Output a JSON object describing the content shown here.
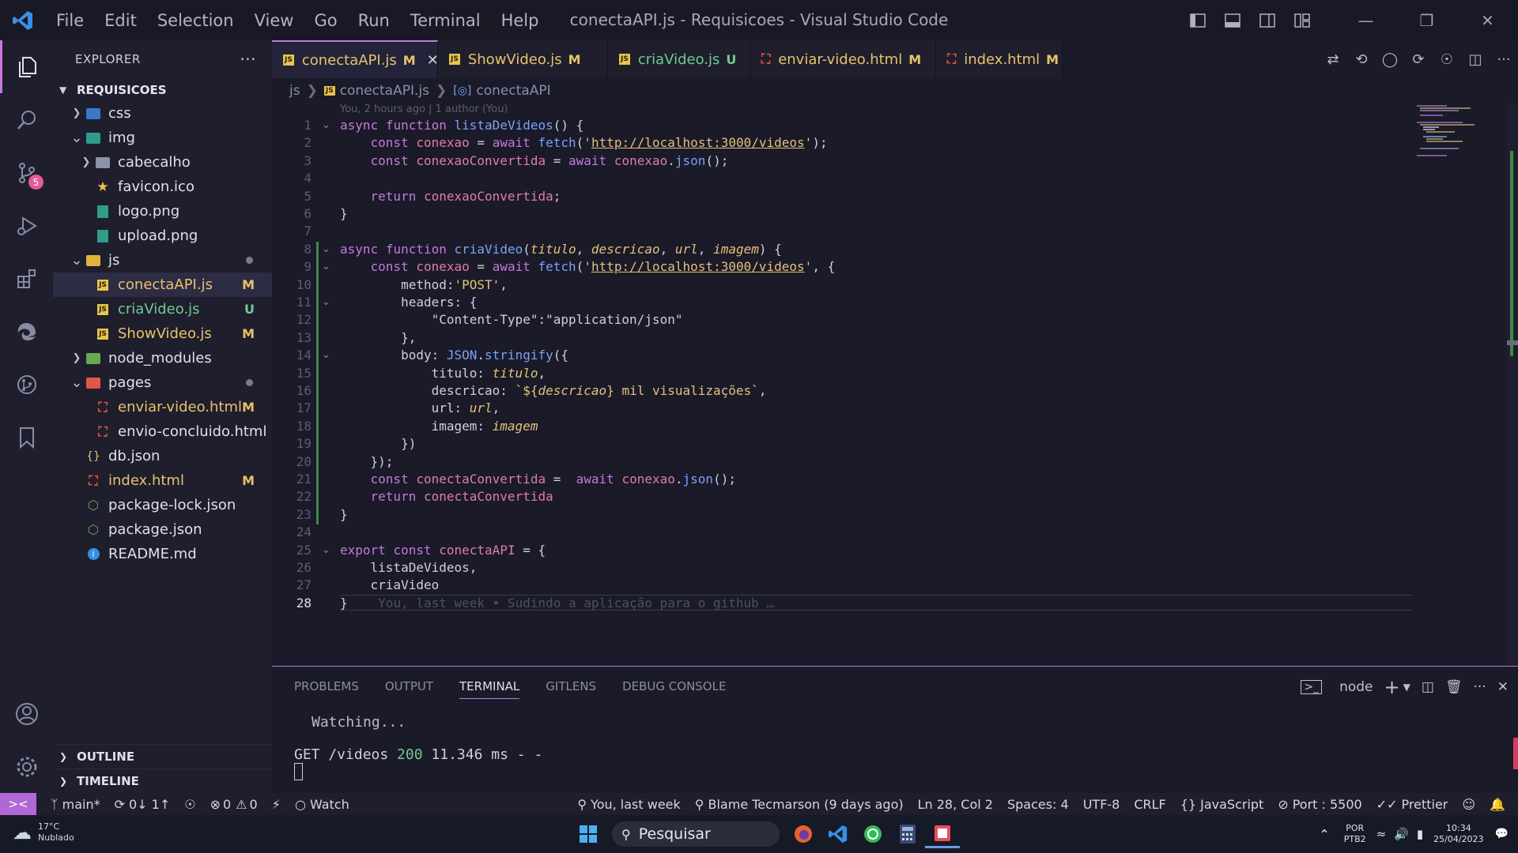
{
  "window": {
    "title": "conectaAPI.js - Requisicoes - Visual Studio Code",
    "menu": [
      "File",
      "Edit",
      "Selection",
      "View",
      "Go",
      "Run",
      "Terminal",
      "Help"
    ]
  },
  "activity_bar": {
    "scm_badge": "5"
  },
  "explorer": {
    "header": "EXPLORER",
    "root": "REQUISICOES",
    "items": [
      {
        "label": "css",
        "depth": 1,
        "kind": "folder-css",
        "expanded": false,
        "status": "",
        "color": ""
      },
      {
        "label": "img",
        "depth": 1,
        "kind": "folder-img",
        "expanded": true,
        "status": "",
        "color": ""
      },
      {
        "label": "cabecalho",
        "depth": 2,
        "kind": "folder",
        "expanded": false,
        "status": "",
        "color": ""
      },
      {
        "label": "favicon.ico",
        "depth": 2,
        "kind": "star",
        "status": "",
        "color": ""
      },
      {
        "label": "logo.png",
        "depth": 2,
        "kind": "image",
        "status": "",
        "color": ""
      },
      {
        "label": "upload.png",
        "depth": 2,
        "kind": "image",
        "status": "",
        "color": ""
      },
      {
        "label": "js",
        "depth": 1,
        "kind": "folder-js",
        "expanded": true,
        "status": "dot",
        "color": "mod"
      },
      {
        "label": "conectaAPI.js",
        "depth": 2,
        "kind": "js",
        "status": "M",
        "color": "mod",
        "selected": true
      },
      {
        "label": "criaVideo.js",
        "depth": 2,
        "kind": "js",
        "status": "U",
        "color": "new"
      },
      {
        "label": "ShowVideo.js",
        "depth": 2,
        "kind": "js",
        "status": "M",
        "color": "mod"
      },
      {
        "label": "node_modules",
        "depth": 1,
        "kind": "folder-node",
        "expanded": false,
        "status": "",
        "color": ""
      },
      {
        "label": "pages",
        "depth": 1,
        "kind": "folder-pages",
        "expanded": true,
        "status": "dot",
        "color": "mod"
      },
      {
        "label": "enviar-video.html",
        "depth": 2,
        "kind": "html",
        "status": "M",
        "color": "mod"
      },
      {
        "label": "envio-concluido.html",
        "depth": 2,
        "kind": "html",
        "status": "",
        "color": ""
      },
      {
        "label": "db.json",
        "depth": 1,
        "kind": "json",
        "status": "",
        "color": ""
      },
      {
        "label": "index.html",
        "depth": 1,
        "kind": "html",
        "status": "M",
        "color": "mod"
      },
      {
        "label": "package-lock.json",
        "depth": 1,
        "kind": "npm",
        "status": "",
        "color": ""
      },
      {
        "label": "package.json",
        "depth": 1,
        "kind": "npm",
        "status": "",
        "color": ""
      },
      {
        "label": "README.md",
        "depth": 1,
        "kind": "info",
        "status": "",
        "color": ""
      }
    ],
    "outline": "OUTLINE",
    "timeline": "TIMELINE"
  },
  "tabs": [
    {
      "label": "conectaAPI.js",
      "mark": "M",
      "kind": "js",
      "active": true,
      "color": "mod"
    },
    {
      "label": "ShowVideo.js",
      "mark": "M",
      "kind": "js",
      "active": false,
      "color": "mod"
    },
    {
      "label": "criaVideo.js",
      "mark": "U",
      "kind": "js",
      "active": false,
      "color": "new"
    },
    {
      "label": "enviar-video.html",
      "mark": "M",
      "kind": "html",
      "active": false,
      "color": "mod"
    },
    {
      "label": "index.html",
      "mark": "M",
      "kind": "html",
      "active": false,
      "color": "mod"
    }
  ],
  "breadcrumb": {
    "folder": "js",
    "file": "conectaAPI.js",
    "symbol": "conectaAPI"
  },
  "editor": {
    "blame_header": "You, 2 hours ago | 1 author (You)",
    "current_line": 28,
    "inline_blame": "You, last week • Sudindo a aplicação para o github …",
    "lines": [
      "async function listaDeVideos() {",
      "    const conexao = await fetch('http://localhost:3000/videos');",
      "    const conexaoConvertida = await conexao.json();",
      "",
      "    return conexaoConvertida;",
      "}",
      "",
      "async function criaVideo(titulo, descricao, url, imagem) {",
      "    const conexao = await fetch('http://localhost:3000/videos', {",
      "        method:'POST',",
      "        headers: {",
      "            \"Content-Type\":\"application/json\"",
      "        },",
      "        body: JSON.stringify({",
      "            titulo: titulo,",
      "            descricao: `${descricao} mil visualizações`,",
      "            url: url,",
      "            imagem: imagem",
      "        })",
      "    });",
      "    const conectaConvertida =  await conexao.json();",
      "    return conectaConvertida",
      "}",
      "",
      "export const conectaAPI = {",
      "    listaDeVideos,",
      "    criaVideo",
      "}"
    ]
  },
  "panel": {
    "tabs": [
      "PROBLEMS",
      "OUTPUT",
      "TERMINAL",
      "GITLENS",
      "DEBUG CONSOLE"
    ],
    "active_tab": "TERMINAL",
    "terminal_name": "node",
    "terminal_lines": [
      "Watching...",
      "GET /videos 200 11.346 ms - -"
    ]
  },
  "status_bar": {
    "branch": "main*",
    "sync": "0↓ 1↑",
    "errors": "0",
    "warnings": "0",
    "watch": "Watch",
    "blame": "You, last week",
    "author": "Blame Tecmarson (9 days ago)",
    "position": "Ln 28, Col 2",
    "spaces": "Spaces: 4",
    "encoding": "UTF-8",
    "eol": "CRLF",
    "language": "JavaScript",
    "port": "Port : 5500",
    "formatter": "Prettier"
  },
  "taskbar": {
    "temperature": "17°C",
    "weather": "Nublado",
    "search": "Pesquisar",
    "lang1": "POR",
    "lang2": "PTB2",
    "time": "10:34",
    "date": "25/04/2023"
  },
  "colors": {
    "accent": "#c678dd",
    "modified": "#e8c26b",
    "untracked": "#73c991",
    "background": "#1a1a28"
  }
}
